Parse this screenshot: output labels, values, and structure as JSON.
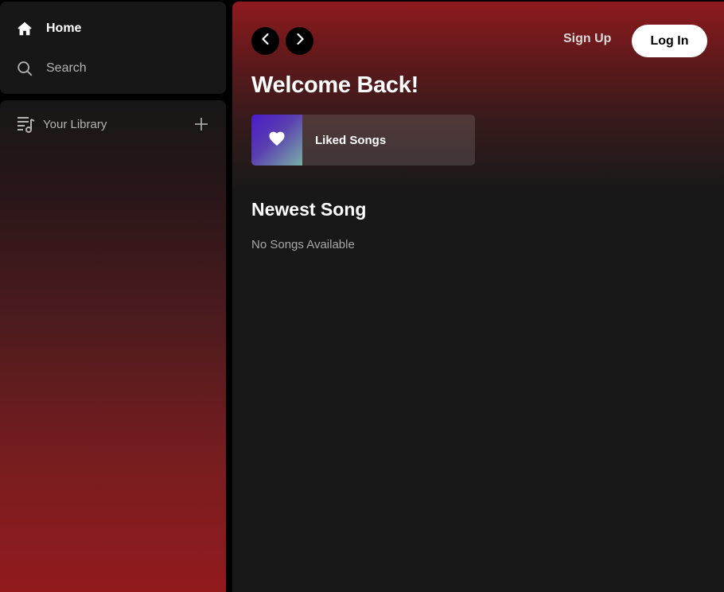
{
  "sidebar": {
    "nav": {
      "home": {
        "label": "Home",
        "icon": "home-icon"
      },
      "search": {
        "label": "Search",
        "icon": "search-icon"
      }
    },
    "library": {
      "label": "Your Library",
      "icon": "library-icon",
      "add_icon": "plus-icon"
    }
  },
  "header": {
    "back_icon": "chevron-left-icon",
    "forward_icon": "chevron-right-icon",
    "signup_label": "Sign Up",
    "login_label": "Log In"
  },
  "main": {
    "greeting": "Welcome Back!",
    "liked": {
      "label": "Liked Songs",
      "icon": "heart-icon"
    },
    "newest": {
      "title": "Newest Song",
      "empty_message": "No Songs Available"
    }
  },
  "colors": {
    "accent_red": "#8e1a1e",
    "panel": "#171717",
    "background": "#181818"
  }
}
